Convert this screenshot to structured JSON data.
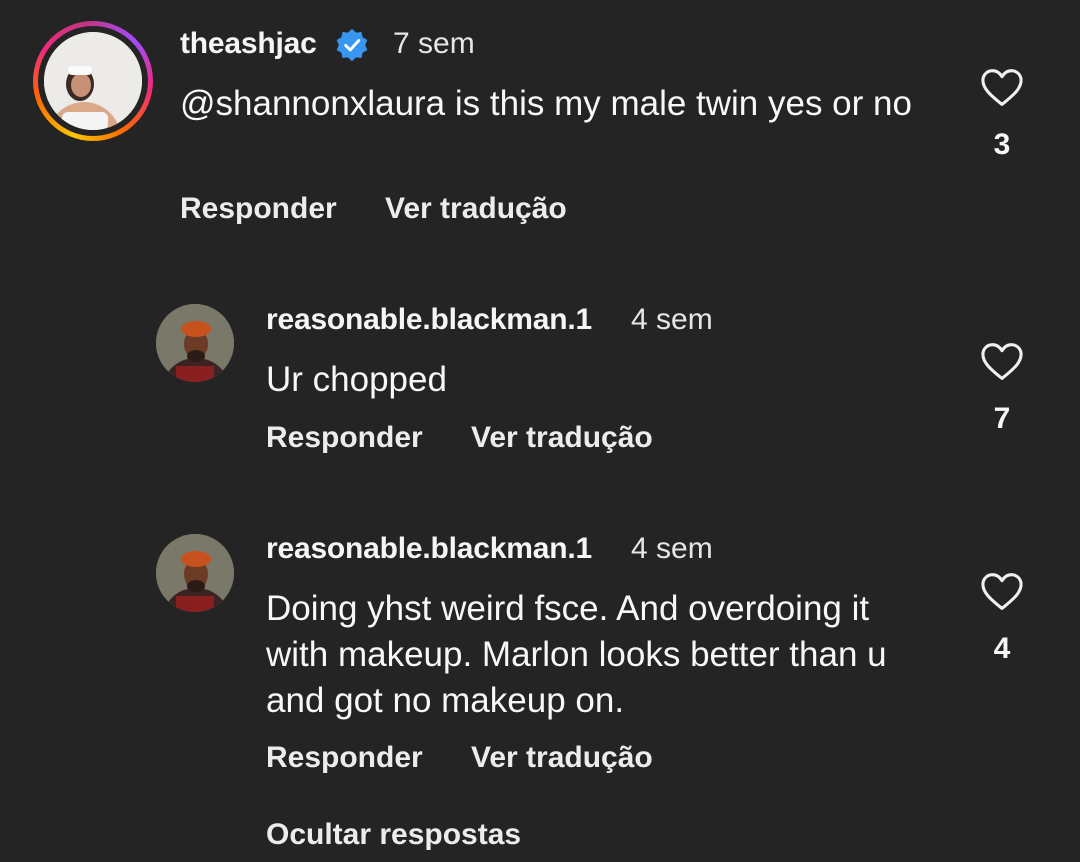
{
  "comments": [
    {
      "username": "theashjac",
      "time": "7 sem",
      "text": "@shannonxlaura is this my male twin yes or no",
      "likes": "3",
      "verified": true
    },
    {
      "username": "reasonable.blackman.1",
      "time": "4 sem",
      "text": "Ur chopped",
      "likes": "7"
    },
    {
      "username": "reasonable.blackman.1",
      "time": "4 sem",
      "text": "Doing yhst weird fsce. And overdoing it with makeup. Marlon looks better than u and got no makeup on.",
      "likes": "4"
    }
  ],
  "actions": {
    "reply": "Responder",
    "translate": "Ver tradução",
    "hide_replies": "Ocultar respostas"
  },
  "colors": {
    "background": "#242424",
    "verified": "#3897f0",
    "text": "#f5f5f5"
  }
}
